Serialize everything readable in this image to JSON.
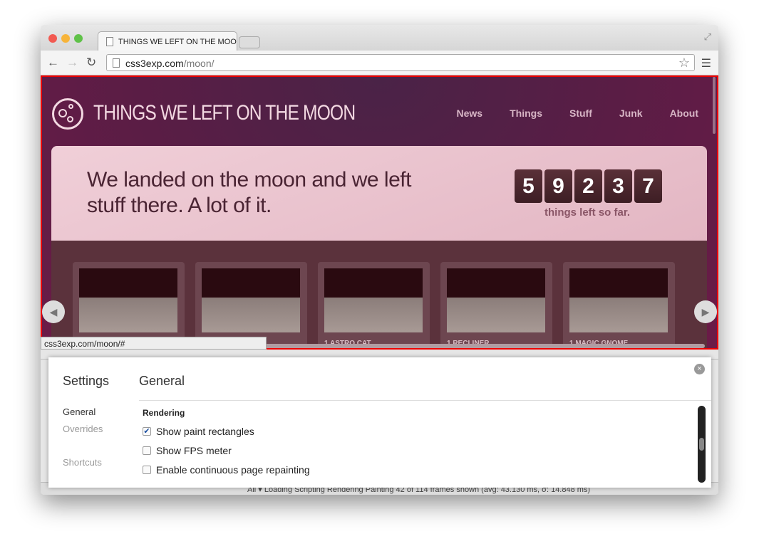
{
  "browser": {
    "tab_title": "THINGS WE LEFT ON THE MOON",
    "url_host": "css3exp.com",
    "url_path": "/moon/",
    "status_url": "css3exp.com/moon/#"
  },
  "site": {
    "title": "THINGS WE LEFT ON THE MOON",
    "nav": [
      "News",
      "Things",
      "Stuff",
      "Junk",
      "About"
    ],
    "headline": "We landed on the moon and we left stuff there. A lot of it.",
    "counter_digits": [
      "5",
      "9",
      "2",
      "3",
      "7"
    ],
    "counter_label": "things left so far.",
    "items": [
      "",
      "",
      "1 ASTRO CAT",
      "1 RECLINER",
      "1 MAGIC GNOME"
    ]
  },
  "devtools": {
    "bottom_text": "All  ▾   Loading   Scripting   Rendering   Painting                    42 of 114 frames shown (avg: 43.130 ms, σ: 14.848 ms)",
    "settings": {
      "title": "Settings",
      "heading": "General",
      "sidebar": [
        "General",
        "Overrides",
        "Shortcuts"
      ],
      "section": "Rendering",
      "options": [
        {
          "label": "Show paint rectangles",
          "checked": true
        },
        {
          "label": "Show FPS meter",
          "checked": false
        },
        {
          "label": "Enable continuous page repainting",
          "checked": false
        }
      ]
    }
  },
  "colors": {
    "page_bg": "#5a1d45",
    "paint_rect": "#ee0000",
    "hero": "#f0cfd8"
  }
}
